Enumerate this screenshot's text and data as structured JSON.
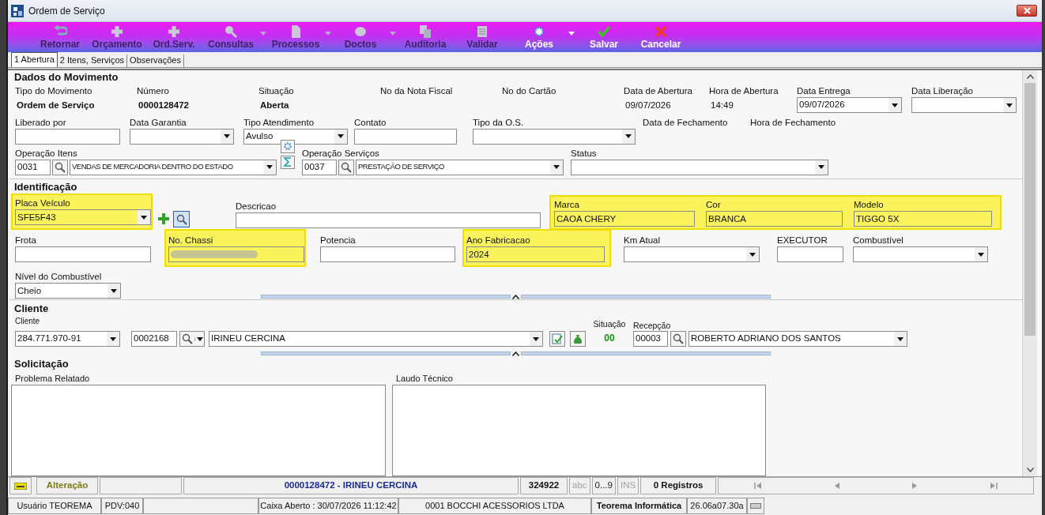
{
  "window": {
    "title": "Ordem de Serviço"
  },
  "toolbar": [
    {
      "label": "Retornar",
      "enabled": false,
      "dropdown": false
    },
    {
      "label": "Orçamento",
      "enabled": false,
      "dropdown": false
    },
    {
      "label": "Ord.Serv.",
      "enabled": false,
      "dropdown": false
    },
    {
      "label": "Consultas",
      "enabled": false,
      "dropdown": true
    },
    {
      "label": "Processos",
      "enabled": false,
      "dropdown": true
    },
    {
      "label": "Doctos",
      "enabled": false,
      "dropdown": true
    },
    {
      "label": "Auditoria",
      "enabled": false,
      "dropdown": false
    },
    {
      "label": "Validar",
      "enabled": false,
      "dropdown": false
    },
    {
      "label": "Ações",
      "enabled": true,
      "dropdown": true
    },
    {
      "label": "Salvar",
      "enabled": true,
      "dropdown": false
    },
    {
      "label": "Cancelar",
      "enabled": true,
      "dropdown": false
    }
  ],
  "tabs": [
    {
      "label": "1 Abertura",
      "selected": true
    },
    {
      "label": "2 Itens, Serviços",
      "selected": false
    },
    {
      "label": "Observações",
      "selected": false
    }
  ],
  "dados_do_movimento": {
    "title": "Dados do Movimento",
    "rows": [
      [
        {
          "kind": "display",
          "label": "Tipo do Movimento",
          "value": "Ordem de Serviço",
          "bold": true
        },
        {
          "kind": "display",
          "label": "Número",
          "value": "0000128472",
          "bold": true
        },
        {
          "kind": "display",
          "label": "Situação",
          "value": "Aberta",
          "bold": true
        },
        {
          "kind": "label",
          "label": "No da Nota Fiscal"
        },
        {
          "kind": "label",
          "label": "No do Cartão"
        },
        {
          "kind": "display",
          "label": "Data de Abertura",
          "value": "09/07/2026",
          "bold": false
        },
        {
          "kind": "display",
          "label": "Hora de Abertura",
          "value": "14:49",
          "bold": false
        },
        {
          "kind": "combo",
          "label": "Data Entrega",
          "value": "09/07/2026"
        },
        {
          "kind": "combo",
          "label": "Data Liberação"
        }
      ],
      [
        {
          "kind": "text",
          "label": "Liberado por"
        },
        {
          "kind": "combo",
          "label": "Data Garantia"
        },
        {
          "kind": "combo",
          "label": "Tipo Atendimento",
          "value": "Avulso"
        },
        {
          "kind": "text",
          "label": "Contato"
        },
        {
          "kind": "combo",
          "label": "Tipo da O.S."
        },
        {
          "kind": "label",
          "label": "Data de Fechamento"
        },
        {
          "kind": "label",
          "label": "Hora de Fechamento"
        }
      ],
      [
        {
          "kind": "lookup",
          "label": "Operação Itens",
          "code": "0031",
          "value": "VENDAS DE MERCADORIA DENTRO DO ESTADO"
        },
        {
          "kind": "tools"
        },
        {
          "kind": "lookup",
          "label": "Operação Serviços",
          "code": "0037",
          "value": "PRESTAÇÃO DE SERVIÇO"
        },
        {
          "kind": "combo",
          "label": "Status"
        }
      ]
    ]
  },
  "identificacao": {
    "title": "Identificação",
    "fields": [
      {
        "kind": "vehicle",
        "label": "Placa Veículo",
        "value": "SFE5F43",
        "highlighted": true
      },
      {
        "kind": "text",
        "label": "Descricao",
        "highlighted": false
      },
      {
        "kind": "group",
        "highlighted": true,
        "fields": [
          {
            "label": "Marca",
            "value": "CAOA CHERY"
          },
          {
            "label": "Cor",
            "value": "BRANCA"
          },
          {
            "label": "Modelo",
            "value": "TIGGO 5X"
          }
        ]
      },
      {
        "kind": "text",
        "label": "Frota",
        "highlighted": false
      },
      {
        "kind": "text",
        "label": "No. Chassi",
        "redacted": true,
        "highlighted": true
      },
      {
        "kind": "text",
        "label": "Potencia",
        "highlighted": false
      },
      {
        "kind": "text",
        "label": "Ano Fabricacao",
        "value": "2024",
        "highlighted": true
      },
      {
        "kind": "combo",
        "label": "Km Atual",
        "highlighted": false
      },
      {
        "kind": "text",
        "label": "EXECUTOR",
        "highlighted": false
      },
      {
        "kind": "combo",
        "label": "Combustível",
        "highlighted": false
      },
      {
        "kind": "combo",
        "label": "Nível do Combustível",
        "value": "Cheio",
        "highlighted": false
      }
    ]
  },
  "cliente": {
    "title": "Cliente",
    "label": "Cliente",
    "document": "284.771.970-91",
    "code": "0002168",
    "name": "IRINEU CERCINA",
    "situacao_label": "Situação",
    "situacao": "00",
    "recepcao_label": "Recepção",
    "recepcao_code": "00003",
    "recepcao_name": "ROBERTO ADRIANO DOS SANTOS"
  },
  "solicitacao": {
    "title": "Solicitação",
    "fields": [
      {
        "label": "Problema Relatado"
      },
      {
        "label": "Laudo Técnico"
      }
    ]
  },
  "status_bar": {
    "mode": "Alteração",
    "record": "0000128472 - IRINEU CERCINA",
    "number": "324922",
    "indicators": [
      {
        "label": "abc",
        "on": false
      },
      {
        "label": "0...9",
        "on": true
      },
      {
        "label": "INS",
        "on": false
      }
    ],
    "records": "0 Registros"
  },
  "footer": [
    {
      "text": "Usuário TEOREMA",
      "emphasis": false
    },
    {
      "text": "PDV:040",
      "emphasis": false
    },
    {
      "text": "Caixa Aberto : 30/07/2026 11:12:42",
      "emphasis": false
    },
    {
      "text": "0001 BOCCHI ACESSORIOS LTDA",
      "emphasis": false
    },
    {
      "text": "Teorema Informática",
      "emphasis": true
    },
    {
      "text": "26.06a07.30a",
      "emphasis": false
    }
  ]
}
